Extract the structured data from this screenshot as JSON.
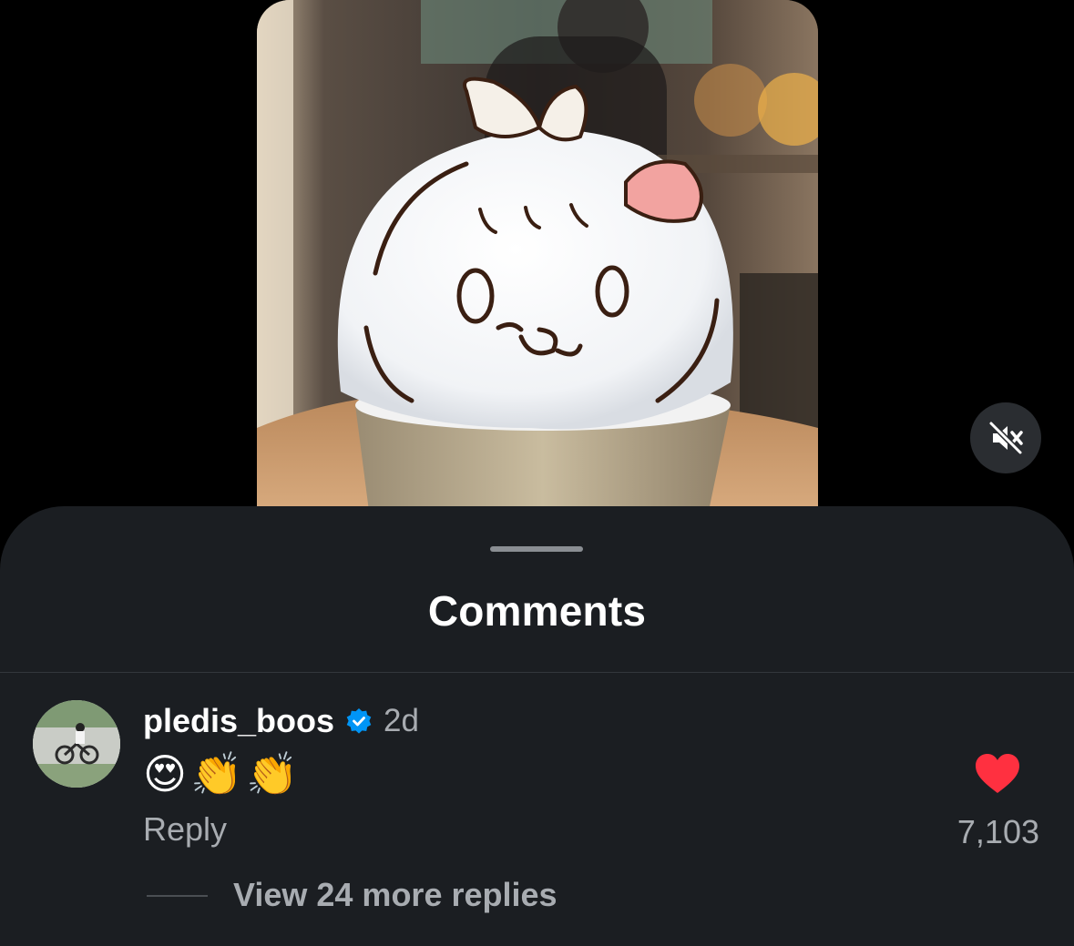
{
  "sheet": {
    "title": "Comments"
  },
  "comment": {
    "username": "pledis_boos",
    "verified": true,
    "timestamp": "2d",
    "text": "😍👏👏",
    "reply_label": "Reply",
    "like_count": "7,103",
    "liked": true,
    "view_replies_label": "View 24 more replies"
  },
  "icons": {
    "mute": "speaker-muted-icon",
    "like": "heart-filled-icon",
    "verified": "verified-badge-icon"
  },
  "colors": {
    "sheet_bg": "#1b1e22",
    "like_red": "#ff3040",
    "verified_blue": "#0095f6",
    "secondary_text": "#a8acb1"
  }
}
